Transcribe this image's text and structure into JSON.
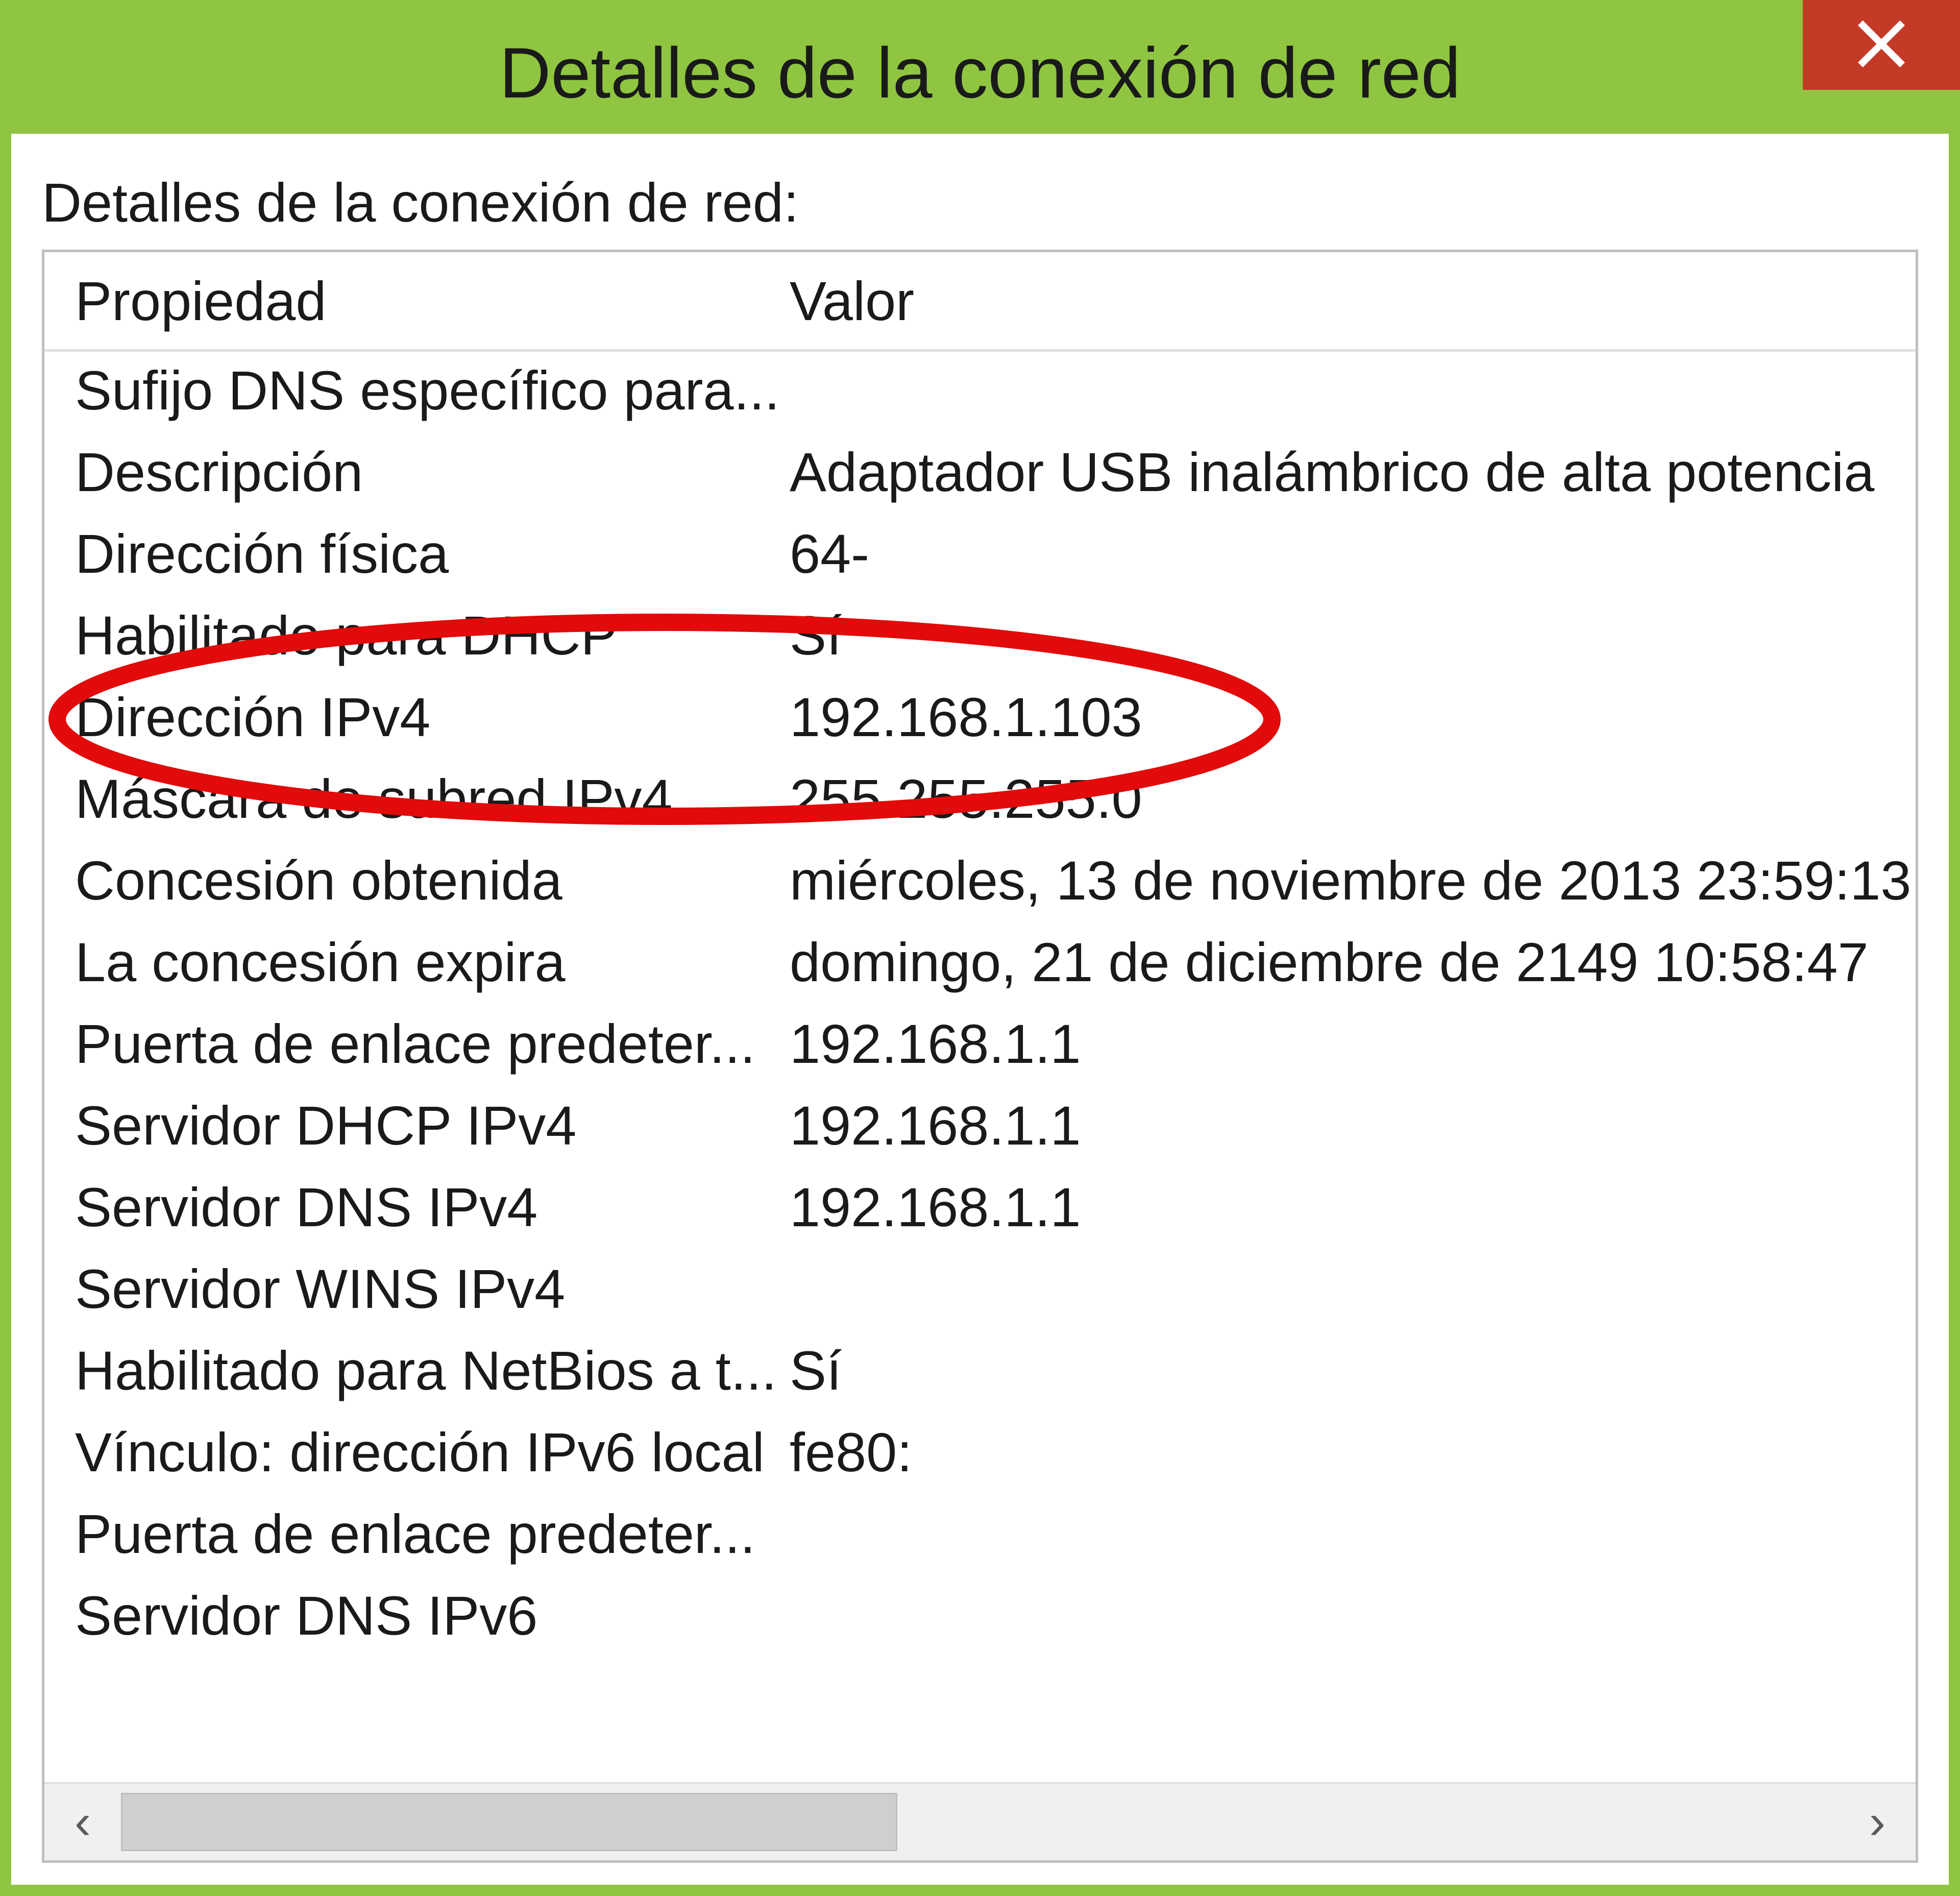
{
  "window": {
    "title": "Detalles de la conexión de red"
  },
  "panel": {
    "label": "Detalles de la conexión de red:",
    "columns": {
      "property": "Propiedad",
      "value": "Valor"
    }
  },
  "rows": [
    {
      "property": "Sufijo DNS específico para...",
      "value": ""
    },
    {
      "property": "Descripción",
      "value": "Adaptador USB inalámbrico de alta potencia"
    },
    {
      "property": "Dirección física",
      "value": "64-"
    },
    {
      "property": "Habilitado para DHCP",
      "value": "Sí"
    },
    {
      "property": "Dirección IPv4",
      "value": "192.168.1.103"
    },
    {
      "property": "Máscara de subred IPv4",
      "value": "255.255.255.0"
    },
    {
      "property": "Concesión obtenida",
      "value": "miércoles, 13 de noviembre de 2013 23:59:13"
    },
    {
      "property": "La concesión expira",
      "value": "domingo, 21 de diciembre de 2149 10:58:47"
    },
    {
      "property": "Puerta de enlace predeter...",
      "value": "192.168.1.1"
    },
    {
      "property": "Servidor DHCP IPv4",
      "value": "192.168.1.1"
    },
    {
      "property": "Servidor DNS IPv4",
      "value": "192.168.1.1"
    },
    {
      "property": "Servidor WINS IPv4",
      "value": ""
    },
    {
      "property": "Habilitado para NetBios a t...",
      "value": "Sí"
    },
    {
      "property": "Vínculo: dirección IPv6 local",
      "value": "fe80:"
    },
    {
      "property": "Puerta de enlace predeter...",
      "value": ""
    },
    {
      "property": "Servidor DNS IPv6",
      "value": ""
    }
  ],
  "scroll": {
    "left_arrow": "‹",
    "right_arrow": "›"
  },
  "annotation": {
    "highlighted_property": "Dirección IPv4",
    "color": "#e20a0a"
  }
}
